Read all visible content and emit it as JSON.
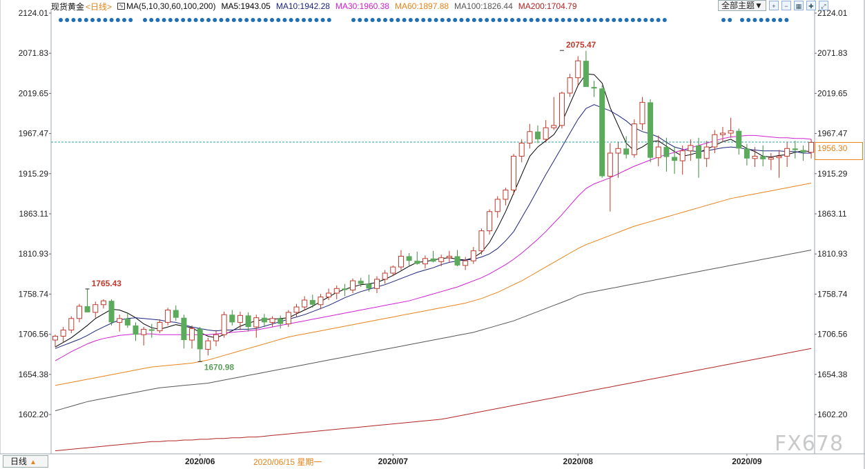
{
  "header": {
    "instrument": "现货黄金",
    "period": "<日线>",
    "ma_params": "MA(5,10,30,60,100,200)",
    "ma_values": [
      {
        "label": "MA5:1943.05",
        "color": "#000000"
      },
      {
        "label": "MA10:1942.28",
        "color": "#1a237e"
      },
      {
        "label": "MA30:1960.38",
        "color": "#d020d0"
      },
      {
        "label": "MA60:1897.88",
        "color": "#e8831a"
      },
      {
        "label": "MA100:1826.44",
        "color": "#555555"
      },
      {
        "label": "MA200:1704.79",
        "color": "#b22222"
      }
    ]
  },
  "toolbar": {
    "theme_label": "全部主题▼",
    "icons": [
      "zoom-in-icon",
      "zoom-out-icon",
      "grid-icon",
      "cross-icon",
      "fullscreen-icon"
    ]
  },
  "footer": {
    "period_button": "日线",
    "cursor_date": "2020/06/15 星期一"
  },
  "watermark": "FX678",
  "colors": {
    "up": "#c0392b",
    "down": "#5cab5c",
    "dots": "#1f6fb5",
    "current_line": "#2aa5a5",
    "axis_text": "#222222"
  },
  "chart_data": {
    "type": "candlestick",
    "y_ticks": [
      "2124.01",
      "2071.83",
      "2019.65",
      "1967.47",
      "1915.29",
      "1863.11",
      "1810.93",
      "1758.74",
      "1706.56",
      "1654.38",
      "1602.20"
    ],
    "ylim": [
      1602.2,
      2124.01
    ],
    "x_labels": [
      {
        "index": 18,
        "label": "2020/06"
      },
      {
        "index": 42,
        "label": "2020/07"
      },
      {
        "index": 65,
        "label": "2020/08"
      },
      {
        "index": 86,
        "label": "2020/09"
      }
    ],
    "current_price": "1956.30",
    "annotations": [
      {
        "index": 4,
        "value": 1765.43,
        "label": "1765.43",
        "kind": "high"
      },
      {
        "index": 18,
        "value": 1670.98,
        "label": "1670.98",
        "kind": "low"
      },
      {
        "index": 63,
        "value": 2075.47,
        "label": "2075.47",
        "kind": "high"
      }
    ],
    "ohlc": [
      [
        1699,
        1706,
        1690,
        1704
      ],
      [
        1704,
        1716,
        1696,
        1712
      ],
      [
        1712,
        1730,
        1708,
        1727
      ],
      [
        1727,
        1746,
        1722,
        1743
      ],
      [
        1743,
        1765,
        1738,
        1735
      ],
      [
        1735,
        1749,
        1728,
        1745
      ],
      [
        1745,
        1752,
        1740,
        1750
      ],
      [
        1750,
        1752,
        1718,
        1722
      ],
      [
        1722,
        1732,
        1710,
        1727
      ],
      [
        1727,
        1734,
        1715,
        1718
      ],
      [
        1718,
        1722,
        1698,
        1706
      ],
      [
        1706,
        1716,
        1692,
        1713
      ],
      [
        1713,
        1720,
        1702,
        1711
      ],
      [
        1711,
        1726,
        1708,
        1722
      ],
      [
        1722,
        1741,
        1718,
        1738
      ],
      [
        1738,
        1744,
        1724,
        1728
      ],
      [
        1728,
        1732,
        1688,
        1699
      ],
      [
        1699,
        1718,
        1688,
        1714
      ],
      [
        1714,
        1716,
        1671,
        1687
      ],
      [
        1687,
        1702,
        1679,
        1698
      ],
      [
        1698,
        1712,
        1691,
        1706
      ],
      [
        1706,
        1736,
        1702,
        1732
      ],
      [
        1732,
        1738,
        1718,
        1722
      ],
      [
        1722,
        1736,
        1712,
        1731
      ],
      [
        1731,
        1735,
        1710,
        1716
      ],
      [
        1716,
        1732,
        1702,
        1728
      ],
      [
        1728,
        1733,
        1716,
        1722
      ],
      [
        1722,
        1730,
        1716,
        1727
      ],
      [
        1727,
        1731,
        1714,
        1720
      ],
      [
        1720,
        1738,
        1716,
        1735
      ],
      [
        1735,
        1746,
        1729,
        1742
      ],
      [
        1742,
        1756,
        1738,
        1751
      ],
      [
        1751,
        1758,
        1741,
        1745
      ],
      [
        1745,
        1759,
        1739,
        1755
      ],
      [
        1755,
        1766,
        1751,
        1760
      ],
      [
        1760,
        1770,
        1752,
        1766
      ],
      [
        1766,
        1772,
        1756,
        1764
      ],
      [
        1764,
        1779,
        1760,
        1776
      ],
      [
        1776,
        1780,
        1768,
        1772
      ],
      [
        1772,
        1784,
        1762,
        1766
      ],
      [
        1766,
        1782,
        1760,
        1778
      ],
      [
        1778,
        1790,
        1772,
        1786
      ],
      [
        1786,
        1796,
        1782,
        1794
      ],
      [
        1794,
        1816,
        1790,
        1808
      ],
      [
        1808,
        1812,
        1796,
        1802
      ],
      [
        1802,
        1814,
        1797,
        1798
      ],
      [
        1798,
        1809,
        1792,
        1805
      ],
      [
        1805,
        1815,
        1800,
        1801
      ],
      [
        1801,
        1810,
        1795,
        1806
      ],
      [
        1806,
        1815,
        1800,
        1808
      ],
      [
        1808,
        1816,
        1795,
        1796
      ],
      [
        1796,
        1807,
        1790,
        1802
      ],
      [
        1802,
        1820,
        1798,
        1815
      ],
      [
        1815,
        1844,
        1810,
        1841
      ],
      [
        1841,
        1869,
        1836,
        1866
      ],
      [
        1866,
        1886,
        1858,
        1882
      ],
      [
        1882,
        1897,
        1874,
        1894
      ],
      [
        1894,
        1941,
        1888,
        1938
      ],
      [
        1938,
        1960,
        1930,
        1955
      ],
      [
        1955,
        1980,
        1948,
        1970
      ],
      [
        1970,
        1978,
        1955,
        1960
      ],
      [
        1960,
        1985,
        1956,
        1975
      ],
      [
        1975,
        2015,
        1972,
        1978
      ],
      [
        1978,
        2022,
        1974,
        2020
      ],
      [
        2020,
        2045,
        2015,
        2040
      ],
      [
        2040,
        2068,
        2030,
        2062
      ],
      [
        2062,
        2075,
        2042,
        2028
      ],
      [
        2028,
        2036,
        2015,
        2026
      ],
      [
        2026,
        2030,
        1910,
        1912
      ],
      [
        1912,
        1955,
        1866,
        1942
      ],
      [
        1942,
        1956,
        1910,
        1948
      ],
      [
        1948,
        1964,
        1935,
        1940
      ],
      [
        1940,
        1986,
        1936,
        1980
      ],
      [
        1980,
        2015,
        1972,
        2008
      ],
      [
        2008,
        2012,
        1930,
        1936
      ],
      [
        1936,
        1965,
        1925,
        1950
      ],
      [
        1950,
        1962,
        1918,
        1937
      ],
      [
        1937,
        1950,
        1915,
        1932
      ],
      [
        1932,
        1952,
        1914,
        1945
      ],
      [
        1945,
        1960,
        1932,
        1952
      ],
      [
        1952,
        1962,
        1910,
        1935
      ],
      [
        1935,
        1958,
        1924,
        1950
      ],
      [
        1950,
        1972,
        1942,
        1966
      ],
      [
        1966,
        1976,
        1956,
        1968
      ],
      [
        1968,
        1988,
        1962,
        1971
      ],
      [
        1971,
        1974,
        1940,
        1948
      ],
      [
        1948,
        1954,
        1926,
        1935
      ],
      [
        1935,
        1950,
        1924,
        1938
      ],
      [
        1938,
        1952,
        1925,
        1934
      ],
      [
        1934,
        1942,
        1920,
        1936
      ],
      [
        1936,
        1946,
        1910,
        1938
      ],
      [
        1938,
        1956,
        1924,
        1948
      ],
      [
        1948,
        1958,
        1935,
        1946
      ],
      [
        1946,
        1952,
        1932,
        1943
      ],
      [
        1943,
        1960,
        1935,
        1956
      ]
    ],
    "ma_series": [
      {
        "name": "MA5",
        "color": "#000000",
        "start": 0,
        "values": [
          1690,
          1696,
          1702,
          1710,
          1718,
          1727,
          1733,
          1739,
          1738,
          1734,
          1728,
          1720,
          1715,
          1713,
          1716,
          1719,
          1717,
          1715,
          1709,
          1704,
          1702,
          1706,
          1711,
          1717,
          1721,
          1724,
          1726,
          1726,
          1727,
          1728,
          1733,
          1738,
          1743,
          1749,
          1755,
          1761,
          1765,
          1768,
          1771,
          1772,
          1774,
          1778,
          1783,
          1789,
          1795,
          1800,
          1801,
          1803,
          1805,
          1806,
          1804,
          1803,
          1806,
          1813,
          1826,
          1845,
          1866,
          1890,
          1914,
          1938,
          1950,
          1958,
          1966,
          1982,
          2006,
          2030,
          2045,
          2044,
          2033,
          2001,
          1978,
          1955,
          1945,
          1950,
          1957,
          1958,
          1951,
          1944,
          1938,
          1940,
          1943,
          1947,
          1952,
          1957,
          1960,
          1954,
          1948,
          1944,
          1938,
          1937,
          1939,
          1940,
          1943,
          1945,
          1944
        ]
      },
      {
        "name": "MA10",
        "color": "#1a237e",
        "start": 0,
        "values": [
          1688,
          1692,
          1696,
          1700,
          1705,
          1711,
          1716,
          1721,
          1725,
          1727,
          1728,
          1727,
          1726,
          1725,
          1723,
          1722,
          1719,
          1716,
          1714,
          1712,
          1711,
          1712,
          1712,
          1713,
          1713,
          1714,
          1717,
          1720,
          1723,
          1726,
          1729,
          1732,
          1736,
          1740,
          1744,
          1749,
          1754,
          1758,
          1762,
          1765,
          1768,
          1771,
          1775,
          1779,
          1783,
          1787,
          1790,
          1793,
          1797,
          1800,
          1802,
          1803,
          1804,
          1807,
          1811,
          1818,
          1828,
          1840,
          1858,
          1876,
          1895,
          1914,
          1932,
          1950,
          1968,
          1986,
          2000,
          2005,
          2001,
          1997,
          1991,
          1984,
          1975,
          1970,
          1967,
          1963,
          1956,
          1950,
          1947,
          1945,
          1944,
          1945,
          1947,
          1949,
          1950,
          1949,
          1947,
          1946,
          1945,
          1945,
          1945,
          1944,
          1944,
          1942,
          1942
        ]
      },
      {
        "name": "MA30",
        "color": "#d020d0",
        "start": 0,
        "values": [
          1672,
          1678,
          1684,
          1689,
          1694,
          1698,
          1701,
          1703,
          1705,
          1706,
          1707,
          1707,
          1707,
          1706,
          1706,
          1706,
          1706,
          1706,
          1706,
          1706,
          1707,
          1708,
          1709,
          1710,
          1711,
          1712,
          1714,
          1716,
          1718,
          1720,
          1722,
          1724,
          1726,
          1728,
          1730,
          1732,
          1734,
          1736,
          1738,
          1740,
          1742,
          1744,
          1746,
          1748,
          1750,
          1753,
          1756,
          1759,
          1762,
          1765,
          1768,
          1772,
          1776,
          1780,
          1785,
          1791,
          1797,
          1804,
          1812,
          1821,
          1830,
          1840,
          1851,
          1862,
          1874,
          1886,
          1896,
          1902,
          1906,
          1910,
          1915,
          1920,
          1925,
          1929,
          1933,
          1937,
          1940,
          1943,
          1946,
          1949,
          1952,
          1955,
          1958,
          1961,
          1963,
          1964,
          1965,
          1965,
          1964,
          1963,
          1962,
          1962,
          1961,
          1961,
          1960
        ]
      },
      {
        "name": "MA60",
        "color": "#e8831a",
        "start": 0,
        "values": [
          1640,
          1642,
          1644,
          1646,
          1648,
          1650,
          1652,
          1654,
          1656,
          1658,
          1660,
          1662,
          1664,
          1665,
          1666,
          1667,
          1668,
          1669,
          1671,
          1673,
          1676,
          1679,
          1682,
          1685,
          1688,
          1691,
          1694,
          1697,
          1700,
          1703,
          1705,
          1707,
          1709,
          1711,
          1713,
          1715,
          1717,
          1719,
          1721,
          1723,
          1725,
          1727,
          1729,
          1731,
          1733,
          1735,
          1737,
          1739,
          1741,
          1743,
          1745,
          1747,
          1750,
          1753,
          1757,
          1761,
          1766,
          1771,
          1776,
          1782,
          1788,
          1794,
          1800,
          1806,
          1812,
          1818,
          1823,
          1827,
          1831,
          1835,
          1839,
          1843,
          1847,
          1850,
          1853,
          1856,
          1859,
          1862,
          1865,
          1868,
          1871,
          1874,
          1877,
          1880,
          1883,
          1885,
          1887,
          1889,
          1891,
          1893,
          1895,
          1897,
          1899,
          1901,
          1903
        ]
      },
      {
        "name": "MA100",
        "color": "#555555",
        "start": 0,
        "values": [
          1607,
          1610,
          1613,
          1616,
          1619,
          1621,
          1623,
          1625,
          1627,
          1629,
          1631,
          1633,
          1635,
          1637,
          1638,
          1639,
          1640,
          1641,
          1642,
          1643,
          1645,
          1647,
          1649,
          1651,
          1653,
          1655,
          1657,
          1659,
          1661,
          1663,
          1665,
          1667,
          1669,
          1671,
          1673,
          1675,
          1677,
          1679,
          1681,
          1683,
          1685,
          1687,
          1689,
          1691,
          1693,
          1695,
          1697,
          1699,
          1701,
          1703,
          1705,
          1707,
          1709,
          1712,
          1715,
          1718,
          1721,
          1724,
          1728,
          1732,
          1736,
          1740,
          1744,
          1748,
          1752,
          1757,
          1760,
          1762,
          1764,
          1766,
          1768,
          1770,
          1772,
          1774,
          1776,
          1778,
          1780,
          1782,
          1784,
          1786,
          1788,
          1790,
          1792,
          1794,
          1796,
          1798,
          1800,
          1802,
          1804,
          1806,
          1808,
          1810,
          1812,
          1814,
          1816
        ]
      },
      {
        "name": "MA200",
        "color": "#b22222",
        "start": 0,
        "values": [
          1555,
          1556,
          1557,
          1558,
          1559,
          1560,
          1561,
          1562,
          1563,
          1564,
          1565,
          1566,
          1567,
          1567,
          1568,
          1568,
          1569,
          1569,
          1570,
          1570,
          1571,
          1571,
          1572,
          1572,
          1573,
          1573,
          1574,
          1575,
          1576,
          1577,
          1578,
          1579,
          1580,
          1581,
          1582,
          1583,
          1584,
          1585,
          1586,
          1587,
          1588,
          1589,
          1590,
          1591,
          1592,
          1593,
          1594,
          1595,
          1596,
          1598,
          1600,
          1602,
          1604,
          1606,
          1608,
          1610,
          1612,
          1614,
          1616,
          1618,
          1620,
          1622,
          1624,
          1626,
          1628,
          1630,
          1632,
          1634,
          1636,
          1638,
          1640,
          1642,
          1644,
          1646,
          1648,
          1650,
          1652,
          1654,
          1656,
          1658,
          1660,
          1662,
          1664,
          1666,
          1668,
          1670,
          1672,
          1674,
          1676,
          1678,
          1680,
          1682,
          1684,
          1686,
          1688
        ]
      }
    ]
  }
}
